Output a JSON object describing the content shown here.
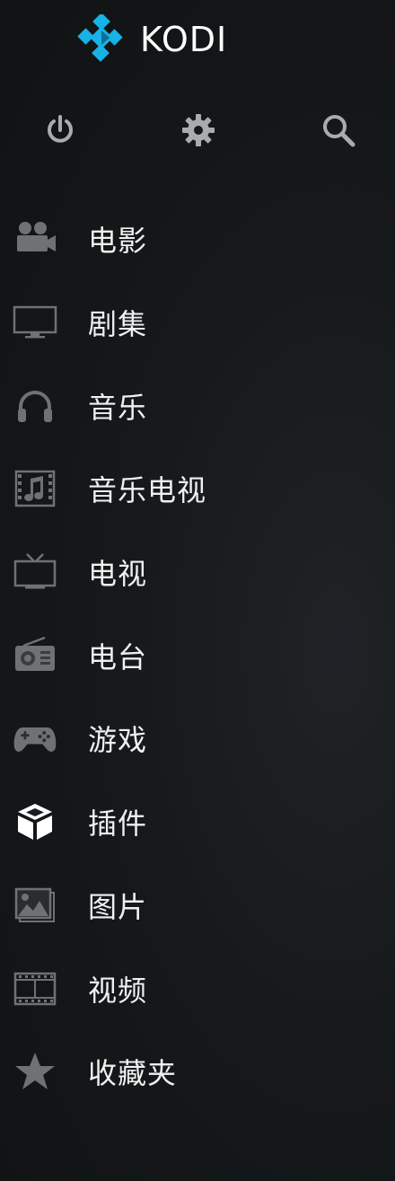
{
  "app": {
    "name": "KODI",
    "logo_icon": "kodi-logo-icon"
  },
  "top_actions": [
    {
      "id": "power",
      "icon": "power-icon"
    },
    {
      "id": "settings",
      "icon": "gear-icon"
    },
    {
      "id": "search",
      "icon": "search-icon"
    }
  ],
  "menu": {
    "items": [
      {
        "label": "电影",
        "icon": "movie-camera-icon"
      },
      {
        "label": "剧集",
        "icon": "monitor-icon"
      },
      {
        "label": "音乐",
        "icon": "headphones-icon"
      },
      {
        "label": "音乐电视",
        "icon": "music-video-icon"
      },
      {
        "label": "电视",
        "icon": "tv-icon"
      },
      {
        "label": "电台",
        "icon": "radio-icon"
      },
      {
        "label": "游戏",
        "icon": "gamepad-icon"
      },
      {
        "label": "插件",
        "icon": "addon-box-icon"
      },
      {
        "label": "图片",
        "icon": "picture-icon"
      },
      {
        "label": "视频",
        "icon": "film-icon"
      },
      {
        "label": "收藏夹",
        "icon": "star-icon"
      }
    ]
  },
  "colors": {
    "logo_blue": "#17B2E6",
    "icon_gray": "#6f7275",
    "icon_light": "#a9acaf",
    "active_icon": "#ffffff",
    "text": "#f0f0f0"
  }
}
